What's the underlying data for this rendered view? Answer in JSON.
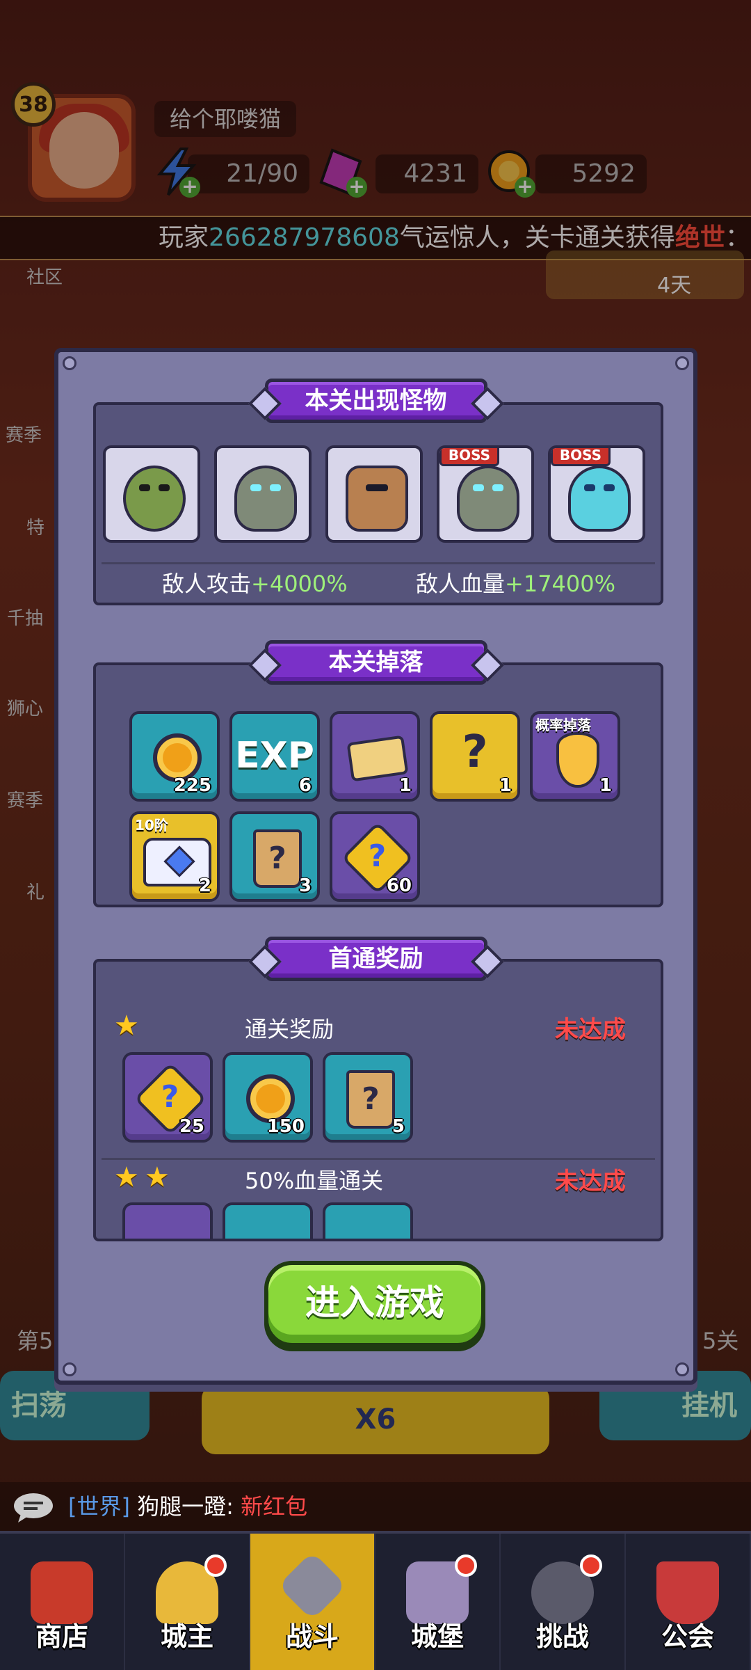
{
  "player": {
    "level": "38",
    "nickname": "给个耶喽猫",
    "energy": "21/90",
    "gems": "4231",
    "coins": "5292"
  },
  "ticker": {
    "prefix": "玩家",
    "player_id": "266287978608",
    "middle": "气运惊人，关卡通关获得",
    "highlight": "绝世",
    "trail": "："
  },
  "sidebar": {
    "community": "社区",
    "event_days": "4天",
    "left_items": [
      "赛季",
      "特",
      "千抽",
      "狮心",
      "赛季",
      "礼"
    ],
    "stage_left": "第5",
    "stage_right": "5关"
  },
  "modal": {
    "monsters": {
      "title": "本关出现怪物",
      "boss_label": "BOSS",
      "enemy_attack_label": "敌人攻击",
      "enemy_attack_value": "+4000%",
      "enemy_hp_label": "敌人血量",
      "enemy_hp_value": "+17400%"
    },
    "drops": {
      "title": "本关掉落",
      "items": [
        {
          "name": "coin",
          "count": "225"
        },
        {
          "name": "exp",
          "label": "EXP",
          "count": "6"
        },
        {
          "name": "ticket",
          "count": "1"
        },
        {
          "name": "gem-pack",
          "count": "1"
        },
        {
          "name": "amber",
          "tag": "概率掉落",
          "count": "1"
        },
        {
          "name": "chest",
          "tag": "10阶",
          "count": "2"
        },
        {
          "name": "mystery-scroll",
          "count": "3"
        },
        {
          "name": "mystery-puzzle",
          "count": "60"
        }
      ]
    },
    "first_clear": {
      "title": "首通奖励",
      "rows": [
        {
          "title": "通关奖励",
          "status": "未达成",
          "items": [
            {
              "count": "25"
            },
            {
              "count": "150"
            },
            {
              "count": "5"
            }
          ]
        },
        {
          "title": "50%血量通关",
          "status": "未达成"
        }
      ]
    },
    "enter_button": "进入游戏"
  },
  "under": {
    "sweep": "扫荡",
    "multiplier": "X6",
    "idle": "挂机"
  },
  "chat": {
    "channel": "[世界]",
    "user": "狗腿一蹬:",
    "message": "新红包"
  },
  "tabs": [
    "商店",
    "城主",
    "战斗",
    "城堡",
    "挑战",
    "公会"
  ],
  "colors": {
    "banner_purple": "#7a30c8",
    "modal_bg": "#7d7ba4",
    "positive_green": "#9ef07a",
    "status_red": "#ff4a4a",
    "button_green": "#8ad83a",
    "ticker_cyan": "#5ee0e8"
  }
}
